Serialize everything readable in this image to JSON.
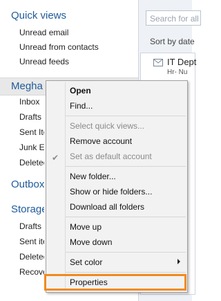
{
  "quick_views": {
    "title": "Quick views",
    "items": [
      "Unread email",
      "Unread from contacts",
      "Unread feeds"
    ]
  },
  "account": {
    "name": "Megha",
    "folders": [
      "Inbox",
      "Drafts",
      "Sent Items",
      "Junk E-mail",
      "Deleted Items"
    ]
  },
  "outbox": {
    "label": "Outbox"
  },
  "storage": {
    "title": "Storage Folders",
    "folders": [
      "Drafts",
      "Sent items",
      "Deleted items",
      "Recovered items"
    ]
  },
  "list_pane": {
    "search_placeholder": "Search for all",
    "sort_label": "Sort by date",
    "message": {
      "sender": "IT Dept",
      "subject": "Hr- Nu"
    }
  },
  "context_menu": {
    "open": "Open",
    "find": "Find...",
    "select_quick_views": "Select quick views...",
    "remove_account": "Remove account",
    "set_default": "Set as default account",
    "new_folder": "New folder...",
    "show_hide": "Show or hide folders...",
    "download_all": "Download all folders",
    "move_up": "Move up",
    "move_down": "Move down",
    "set_color": "Set color",
    "properties": "Properties"
  },
  "colors": {
    "section_title": "#1f5b9a",
    "highlight_border": "#f28a1e"
  }
}
